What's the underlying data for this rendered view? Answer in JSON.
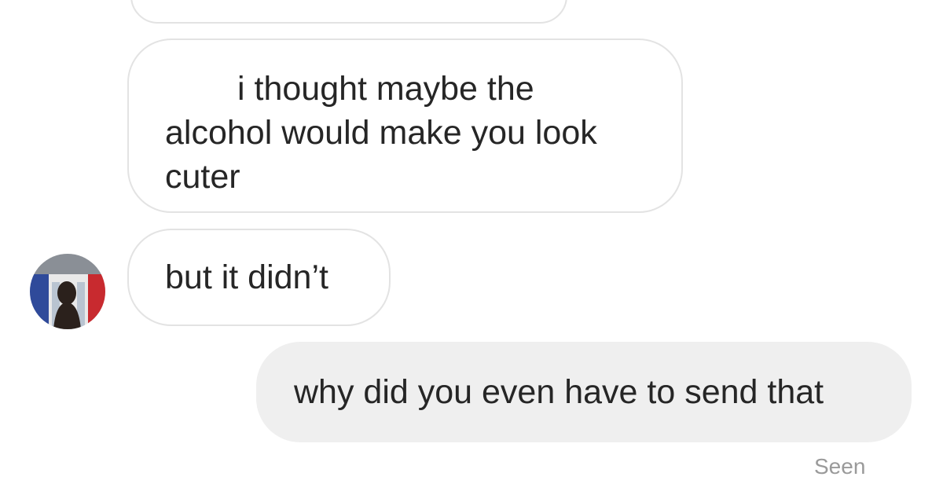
{
  "conversation": {
    "messages": [
      {
        "sender": "them",
        "lines": [
          "i thought maybe the",
          "alcohol would make you look",
          "cuter"
        ]
      },
      {
        "sender": "them",
        "text": "but it didn’t"
      },
      {
        "sender": "me",
        "text": "why did you even have to send that"
      }
    ],
    "status": "Seen",
    "colors": {
      "incoming_bubble_border": "#e3e3e3",
      "outgoing_bubble_fill": "#efefef",
      "text": "#262626",
      "status_text": "#9a9a9a"
    },
    "avatar_icon": "profile-photo-avatar"
  }
}
